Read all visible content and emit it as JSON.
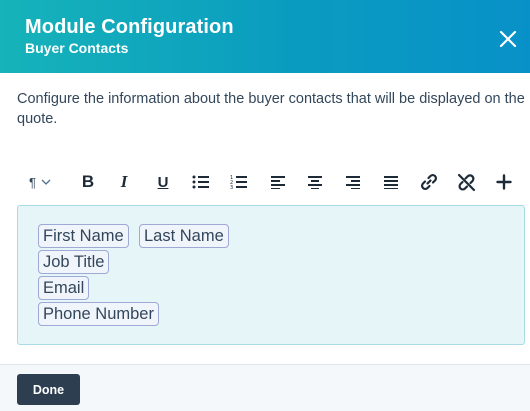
{
  "header": {
    "title": "Module Configuration",
    "subtitle": "Buyer Contacts",
    "close_icon": "close-icon"
  },
  "description": "Configure the information about the buyer contacts that will be displayed on the quote.",
  "toolbar": {
    "paragraph_symbol": "¶",
    "bold_label": "B",
    "italic_label": "I",
    "underline_label": "U",
    "icons": [
      "paragraph-style-icon",
      "chevron-down-icon",
      "bold-icon",
      "italic-icon",
      "underline-icon",
      "bulleted-list-icon",
      "numbered-list-icon",
      "align-left-icon",
      "align-center-icon",
      "align-right-icon",
      "justify-icon",
      "link-icon",
      "unlink-icon",
      "plus-icon"
    ]
  },
  "editor": {
    "tokens": [
      "First Name",
      "Last Name",
      "Job Title",
      "Email",
      "Phone Number"
    ]
  },
  "footer": {
    "done_label": "Done"
  },
  "colors": {
    "header_gradient_start": "#16b3ba",
    "header_gradient_end": "#0891c8",
    "editor_background": "#e5f5f8",
    "done_button": "#2d3e50"
  }
}
